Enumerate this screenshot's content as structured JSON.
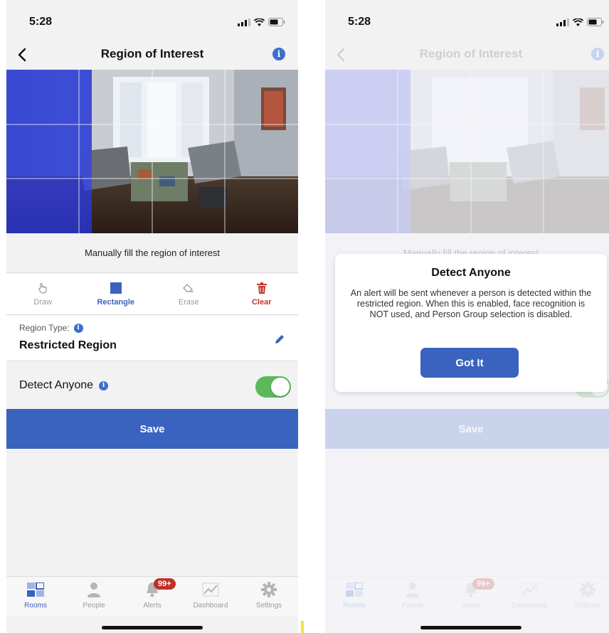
{
  "status": {
    "time": "5:28"
  },
  "nav": {
    "title": "Region of Interest",
    "info_glyph": "i"
  },
  "instruction": "Manually fill the region of interest",
  "tools": [
    {
      "label": "Draw",
      "icon": "draw-hand-icon"
    },
    {
      "label": "Rectangle",
      "icon": "rectangle-icon",
      "active": true
    },
    {
      "label": "Erase",
      "icon": "eraser-icon"
    },
    {
      "label": "Clear",
      "icon": "trash-icon",
      "danger": true
    }
  ],
  "region": {
    "label": "Region Type:",
    "value": "Restricted Region"
  },
  "detect": {
    "label": "Detect Anyone",
    "enabled": true
  },
  "save_label": "Save",
  "tabs": [
    {
      "label": "Rooms",
      "icon": "rooms-icon",
      "active": true
    },
    {
      "label": "People",
      "icon": "person-icon"
    },
    {
      "label": "Alerts",
      "icon": "bell-icon",
      "badge": "99+"
    },
    {
      "label": "Dashboard",
      "icon": "chart-icon"
    },
    {
      "label": "Settings",
      "icon": "gear-icon"
    }
  ],
  "modal": {
    "title": "Detect Anyone",
    "body": "An alert will be sent whenever a person is detected within the restricted region. When this is enabled, face recognition is NOT used, and Person Group selection is disabled.",
    "button": "Got It"
  },
  "colors": {
    "accent": "#3a62bf",
    "toggle_on": "#5cb85c",
    "danger": "#c0392b",
    "badge": "#c0302b",
    "region_overlay": "#2a3cff"
  }
}
